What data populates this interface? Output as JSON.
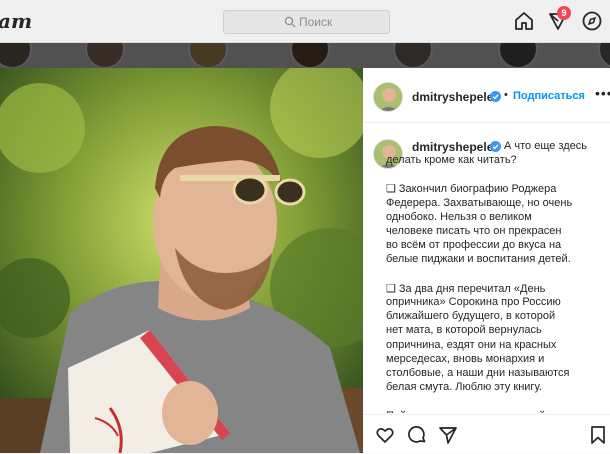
{
  "topbar": {
    "logo_fragment": "am",
    "search_placeholder": "Поиск",
    "activity_badge": "9"
  },
  "post": {
    "username": "dmitryshepelev",
    "follow_label": "Подписаться",
    "dot": "•",
    "more": "•••",
    "caption_first_line": "А что еще здесь",
    "caption_lines": [
      "делать кроме как читать?",
      "",
      "❑ Закончил биографию Роджера",
      "Федерера. Захватывающе, но очень",
      "однобоко. Нельзя о великом",
      "человеке писать что он прекрасен",
      "во всём от профессии до вкуса на",
      "белые пиджаки и воспитания детей.",
      "",
      "❑ За два дня перечитал «День",
      "опричника» Сорокина про Россию",
      "ближайшего будущего, в которой",
      "нет мата, в которой вернулась",
      "опричнина, ездят они на красных",
      "мерседесах, вновь монархия и",
      "столбовые, а наши дни называются",
      "белая смута. Люблю эту книгу.",
      "",
      "Пойду кремом от солнца детей"
    ]
  },
  "colors": {
    "accent": "#0095f6",
    "badge": "#ed4956",
    "overlay": "rgba(0,0,0,0.65)"
  },
  "icons": [
    "search-icon",
    "home-icon",
    "activity-icon",
    "explore-icon",
    "verified-icon",
    "like-icon",
    "comment-icon",
    "share-icon",
    "save-icon"
  ]
}
